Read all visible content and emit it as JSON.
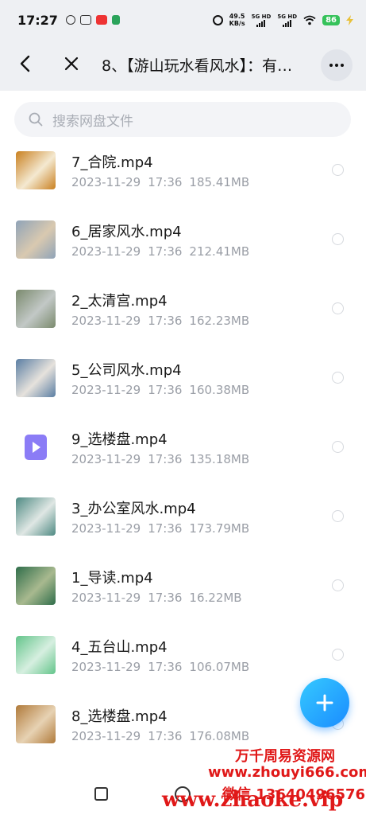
{
  "status_bar": {
    "time": "17:27",
    "net_speed_value": "49.5",
    "net_speed_unit": "KB/s",
    "sim1": "5G HD",
    "sim2": "5G HD",
    "battery": "86"
  },
  "header": {
    "title": "8、【游山玩水看风水】：有…"
  },
  "search": {
    "placeholder": "搜索网盘文件"
  },
  "files": [
    {
      "name": "7_合院.mp4",
      "date": "2023-11-29",
      "time": "17:36",
      "size": "185.41MB",
      "thumb_colors": [
        "#c9801f",
        "#f4e9d1"
      ]
    },
    {
      "name": "6_居家风水.mp4",
      "date": "2023-11-29",
      "time": "17:36",
      "size": "212.41MB",
      "thumb_colors": [
        "#8fa3b8",
        "#d9c9b0"
      ]
    },
    {
      "name": "2_太清宫.mp4",
      "date": "2023-11-29",
      "time": "17:36",
      "size": "162.23MB",
      "thumb_colors": [
        "#7a8a6d",
        "#c2c8c6"
      ]
    },
    {
      "name": "5_公司风水.mp4",
      "date": "2023-11-29",
      "time": "17:36",
      "size": "160.38MB",
      "thumb_colors": [
        "#5a7ea3",
        "#e6e2dc"
      ]
    },
    {
      "name": "9_选楼盘.mp4",
      "date": "2023-11-29",
      "time": "17:36",
      "size": "135.18MB",
      "thumb_colors": null
    },
    {
      "name": "3_办公室风水.mp4",
      "date": "2023-11-29",
      "time": "17:36",
      "size": "173.79MB",
      "thumb_colors": [
        "#4e8a83",
        "#dfe7e4"
      ]
    },
    {
      "name": "1_导读.mp4",
      "date": "2023-11-29",
      "time": "17:36",
      "size": "16.22MB",
      "thumb_colors": [
        "#2f6d4a",
        "#a8b98f"
      ]
    },
    {
      "name": "4_五台山.mp4",
      "date": "2023-11-29",
      "time": "17:36",
      "size": "106.07MB",
      "thumb_colors": [
        "#63c48a",
        "#d6efe0"
      ]
    },
    {
      "name": "8_选楼盘.mp4",
      "date": "2023-11-29",
      "time": "17:36",
      "size": "176.08MB",
      "thumb_colors": [
        "#b07a3a",
        "#e7d2b3"
      ]
    }
  ],
  "watermark": {
    "line1": "万千周易资源网",
    "line2": "www.zhouyi666.com",
    "line3": "微信 13640496576",
    "line4": "www.zhaoke.vip"
  },
  "colors": {
    "accent": "#1a8cff",
    "watermark": "#e01818",
    "video_icon": "#8b7cf6"
  }
}
